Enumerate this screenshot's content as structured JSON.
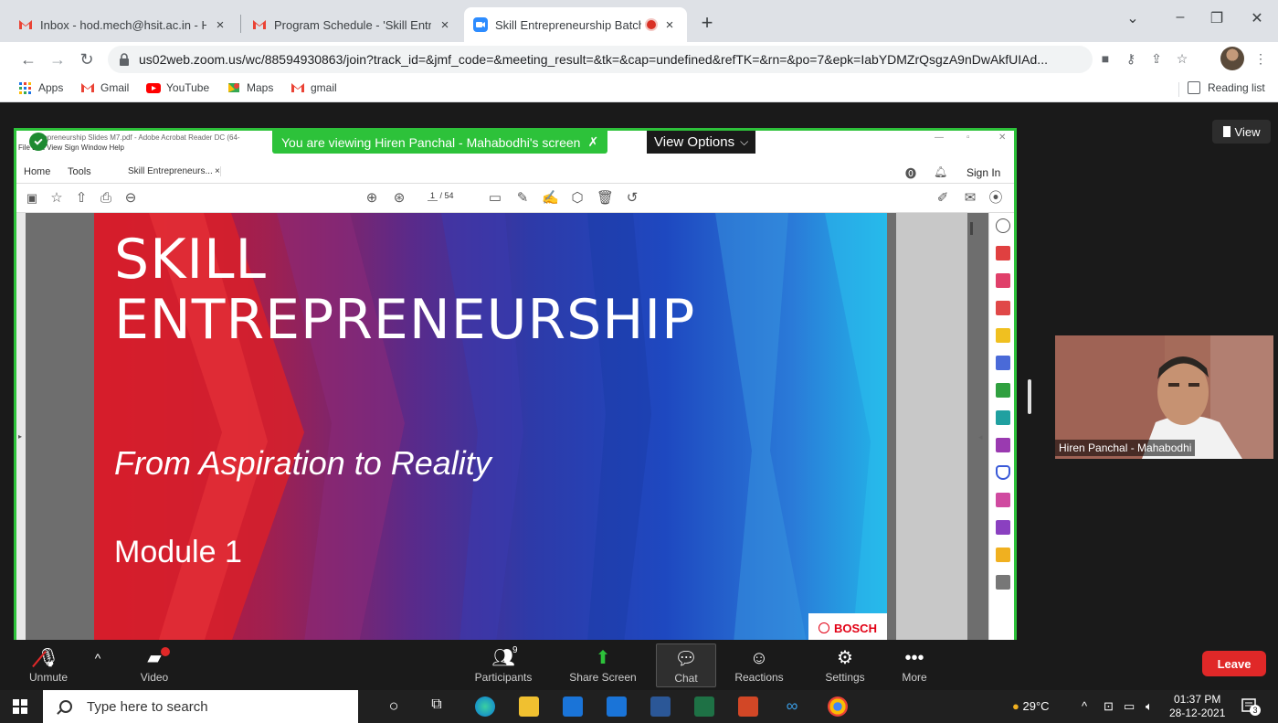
{
  "browser": {
    "tabs": [
      {
        "title": "Inbox - hod.mech@hsit.ac.in - Hi",
        "close": "×"
      },
      {
        "title": "Program Schedule - 'Skill Entrepr",
        "close": "×"
      },
      {
        "title": "Skill Entrepreneurship Batch",
        "close": "×"
      }
    ],
    "new_tab": "+",
    "url": "us02web.zoom.us/wc/88594930863/join?track_id=&jmf_code=&meeting_result=&tk=&cap=undefined&refTK=&rn=&po=7&epk=IabYDMZrQsgzA9nDwAkfUIAd...",
    "bookmarks": [
      "Apps",
      "Gmail",
      "YouTube",
      "Maps",
      "gmail"
    ],
    "reading_list": "Reading list",
    "colors": {
      "accent": "#1a73e8",
      "gmail_red": "#ea4335"
    }
  },
  "zoom": {
    "view_button": "View",
    "viewing_banner": "You are viewing Hiren Panchal - Mahabodhi's screen",
    "view_options": "View Options",
    "participant_name": "Hiren Panchal - Mahabodhi",
    "toolbar": {
      "unmute": "Unmute",
      "video": "Video",
      "participants": "Participants",
      "participants_count": "9",
      "share_screen": "Share Screen",
      "chat": "Chat",
      "reactions": "Reactions",
      "settings": "Settings",
      "more": "More",
      "leave": "Leave"
    },
    "colors": {
      "share_border": "#2dc23a",
      "leave": "#e02828"
    }
  },
  "acrobat": {
    "window_title": "ntrepreneurship Slides M7.pdf - Adobe Acrobat Reader DC (64-",
    "menu": "File  Edit  View  Sign  Window  Help",
    "tab_home": "Home",
    "tab_tools": "Tools",
    "tab_doc": "Skill Entrepreneurs...",
    "sign_in": "Sign In",
    "page_current": "1",
    "page_total": "/ 54"
  },
  "slide": {
    "title_line1": "SKILL",
    "title_line2": "ENTREPRENEURSHIP",
    "subtitle": "From Aspiration to Reality",
    "module": "Module 1",
    "brand": "BOSCH"
  },
  "taskbar": {
    "search_placeholder": "Type here to search",
    "weather": "29°C",
    "time": "01:37 PM",
    "date": "28-12-2021",
    "notification_count": "3"
  }
}
